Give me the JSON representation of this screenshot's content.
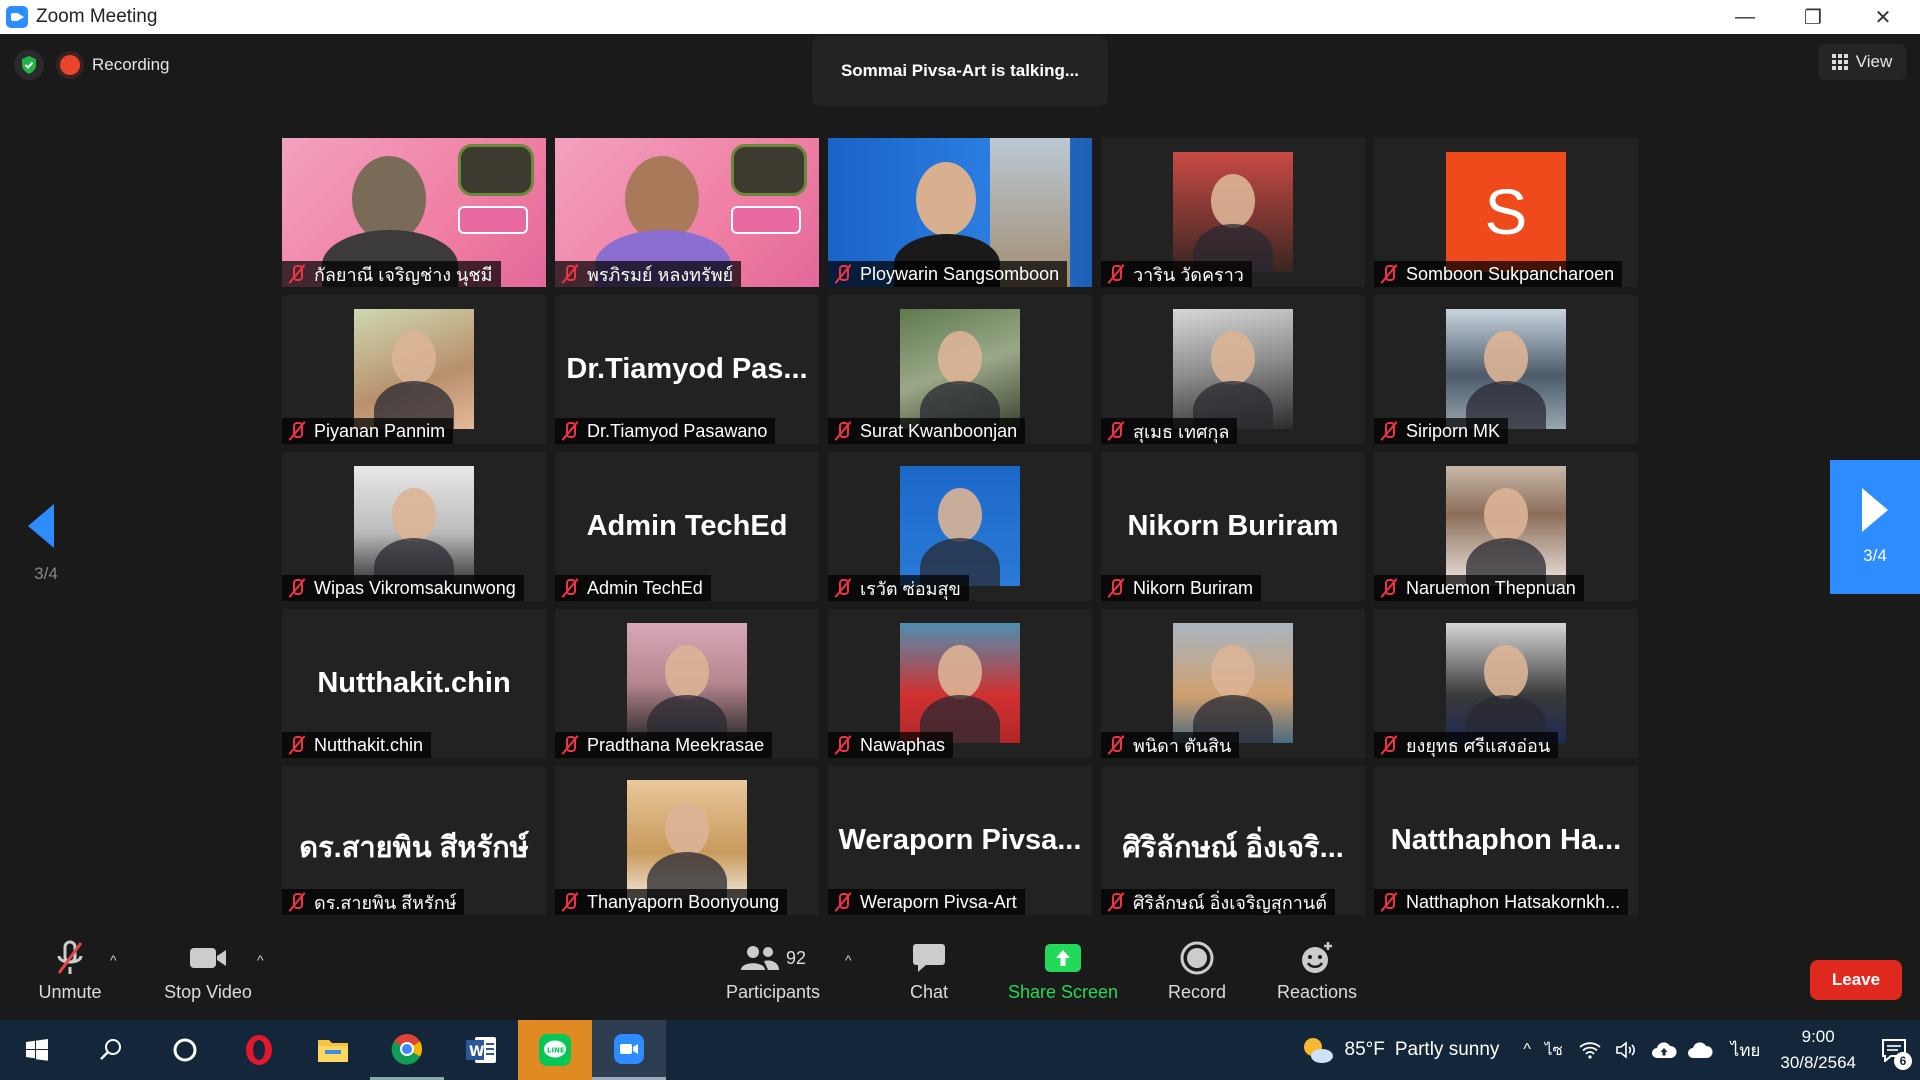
{
  "window": {
    "title": "Zoom Meeting",
    "min": "—",
    "restore": "❐",
    "close": "✕"
  },
  "status": {
    "recording": "Recording",
    "talking": "Sommai Pivsa-Art is talking...",
    "view": "View"
  },
  "nav": {
    "page": "3/4"
  },
  "tiles": [
    {
      "name": "กัลยาณี เจริญช่าง นุชมี",
      "type": "video"
    },
    {
      "name": "พรภิรมย์ หลงทรัพย์",
      "type": "video"
    },
    {
      "name": "Ploywarin Sangsomboon",
      "type": "video"
    },
    {
      "name": "วาริน วัดคราว",
      "type": "photo"
    },
    {
      "name": "Somboon Sukpancharoen",
      "type": "avatar",
      "initial": "S"
    },
    {
      "name": "Piyanan Pannim",
      "type": "photo"
    },
    {
      "name": "Dr.Tiamyod Pasawano",
      "type": "text",
      "big": "Dr.Tiamyod  Pas..."
    },
    {
      "name": "Surat Kwanboonjan",
      "type": "photo"
    },
    {
      "name": "สุเมธ เทศกุล",
      "type": "photo"
    },
    {
      "name": "Siriporn MK",
      "type": "photo"
    },
    {
      "name": "Wipas Vikromsakunwong",
      "type": "photo"
    },
    {
      "name": "Admin TechEd",
      "type": "text",
      "big": "Admin TechEd"
    },
    {
      "name": "เรวัต ซ่อมสุข",
      "type": "photo"
    },
    {
      "name": "Nikorn Buriram",
      "type": "text",
      "big": "Nikorn Buriram"
    },
    {
      "name": "Naruemon Thepnuan",
      "type": "photo"
    },
    {
      "name": "Nutthakit.chin",
      "type": "text",
      "big": "Nutthakit.chin"
    },
    {
      "name": "Pradthana Meekrasae",
      "type": "photo"
    },
    {
      "name": "Nawaphas",
      "type": "photo"
    },
    {
      "name": "พนิดา ตันสิน",
      "type": "photo"
    },
    {
      "name": "ยงยุทธ ศรีแสงอ่อน",
      "type": "photo"
    },
    {
      "name": "ดร.สายพิน  สีหรักษ์",
      "type": "text",
      "big": "ดร.สายพิน  สีหรักษ์"
    },
    {
      "name": "Thanyaporn Boonyoung",
      "type": "photo"
    },
    {
      "name": "Weraporn Pivsa-Art",
      "type": "text",
      "big": "Weraporn  Pivsa..."
    },
    {
      "name": "ศิริลักษณ์ อิ่งเจริญสุกานต์",
      "type": "text",
      "big": "ศิริลักษณ์ อิ่งเจริ..."
    },
    {
      "name": "Natthaphon Hatsakornkh...",
      "type": "text",
      "big": "Natthaphon  Ha..."
    }
  ],
  "toolbar": {
    "unmute": "Unmute",
    "stop_video": "Stop Video",
    "participants": "Participants",
    "participants_count": "92",
    "chat": "Chat",
    "share_screen": "Share Screen",
    "record": "Record",
    "reactions": "Reactions",
    "leave": "Leave"
  },
  "taskbar": {
    "weather_temp": "85°F",
    "weather_desc": "Partly sunny",
    "lang": "ไทย",
    "ime": "ไซ",
    "time": "9:00",
    "date": "30/8/2564",
    "notif_count": "6"
  },
  "colors": {
    "accent": "#2d8cff",
    "leave": "#e0291f",
    "share": "#23d959",
    "mute": "#e34444"
  }
}
